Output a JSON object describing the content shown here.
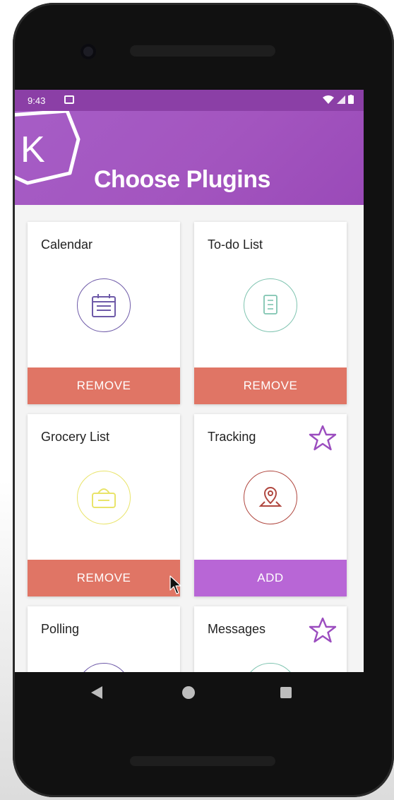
{
  "status_bar": {
    "time": "9:43"
  },
  "header": {
    "title": "Choose Plugins",
    "logo_letter": "K"
  },
  "plugins": [
    {
      "title": "Calendar",
      "button": "REMOVE",
      "icon": "calendar-icon",
      "icon_color": "#6e5aa8",
      "starred": false
    },
    {
      "title": "To-do List",
      "button": "REMOVE",
      "icon": "notepad-icon",
      "icon_color": "#7fc4b0",
      "starred": false
    },
    {
      "title": "Grocery List",
      "button": "REMOVE",
      "icon": "basket-icon",
      "icon_color": "#e9e46a",
      "starred": false
    },
    {
      "title": "Tracking",
      "button": "ADD",
      "icon": "location-pin-icon",
      "icon_color": "#b0473f",
      "starred": true
    },
    {
      "title": "Polling",
      "button": "",
      "icon": "poll-icon",
      "icon_color": "#6e5aa8",
      "starred": false
    },
    {
      "title": "Messages",
      "button": "",
      "icon": "message-icon",
      "icon_color": "#7fc4b0",
      "starred": true
    }
  ],
  "colors": {
    "accent": "#a355bf",
    "status_bar": "#8b3fa6",
    "remove_button": "#e07565",
    "add_button": "#b866d6"
  },
  "nav": {
    "back_icon": "back-icon",
    "home_icon": "home-icon",
    "recents_icon": "recents-icon"
  }
}
